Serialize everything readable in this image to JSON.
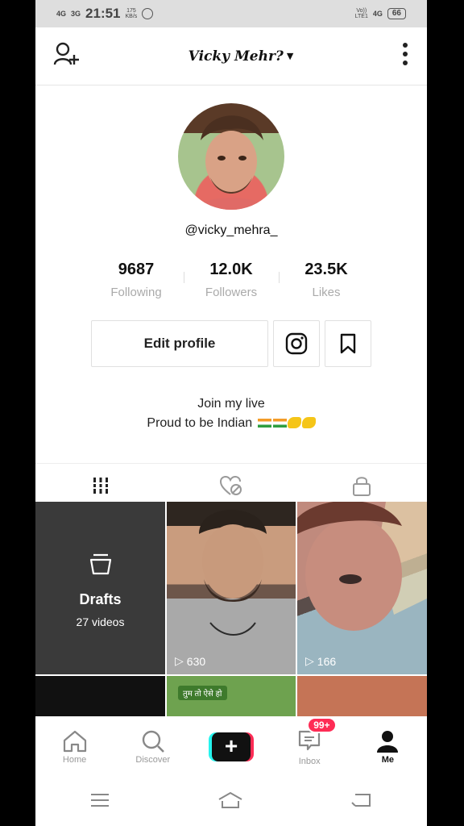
{
  "status_bar": {
    "signal_left": "4G",
    "signal_right": "3G",
    "time": "21:51",
    "net_speed_value": "175",
    "net_speed_unit": "KB/s",
    "volte": "Vo))",
    "lte": "LTE1",
    "signal_4g": "4G",
    "battery": "66"
  },
  "header": {
    "username": "Vicky Mehr?",
    "add_friend_icon": "add-user-icon",
    "more_icon": "vertical-dots-icon"
  },
  "profile": {
    "handle": "@vicky_mehra_",
    "stats": [
      {
        "value": "9687",
        "label": "Following"
      },
      {
        "value": "12.0K",
        "label": "Followers"
      },
      {
        "value": "23.5K",
        "label": "Likes"
      }
    ],
    "edit_label": "Edit profile",
    "bio_line1": "Join my live",
    "bio_line2": "Proud to be Indian"
  },
  "tabs": [
    {
      "name": "videos",
      "icon": "grid-bars-icon",
      "active": true
    },
    {
      "name": "liked",
      "icon": "heart-hidden-icon",
      "active": false
    },
    {
      "name": "private",
      "icon": "lock-icon",
      "active": false
    }
  ],
  "grid": {
    "drafts_title": "Drafts",
    "drafts_count": "27 videos",
    "videos": [
      {
        "plays": "630"
      },
      {
        "plays": "166"
      }
    ],
    "overlay_text": "तुम तो ऐसे हो"
  },
  "bottom_nav": {
    "home": "Home",
    "discover": "Discover",
    "create": "+",
    "inbox": "Inbox",
    "inbox_badge": "99+",
    "me": "Me"
  },
  "colors": {
    "accent_red": "#fe2c55",
    "accent_cyan": "#25f4ee",
    "drafts_bg": "#3a3a3a"
  }
}
